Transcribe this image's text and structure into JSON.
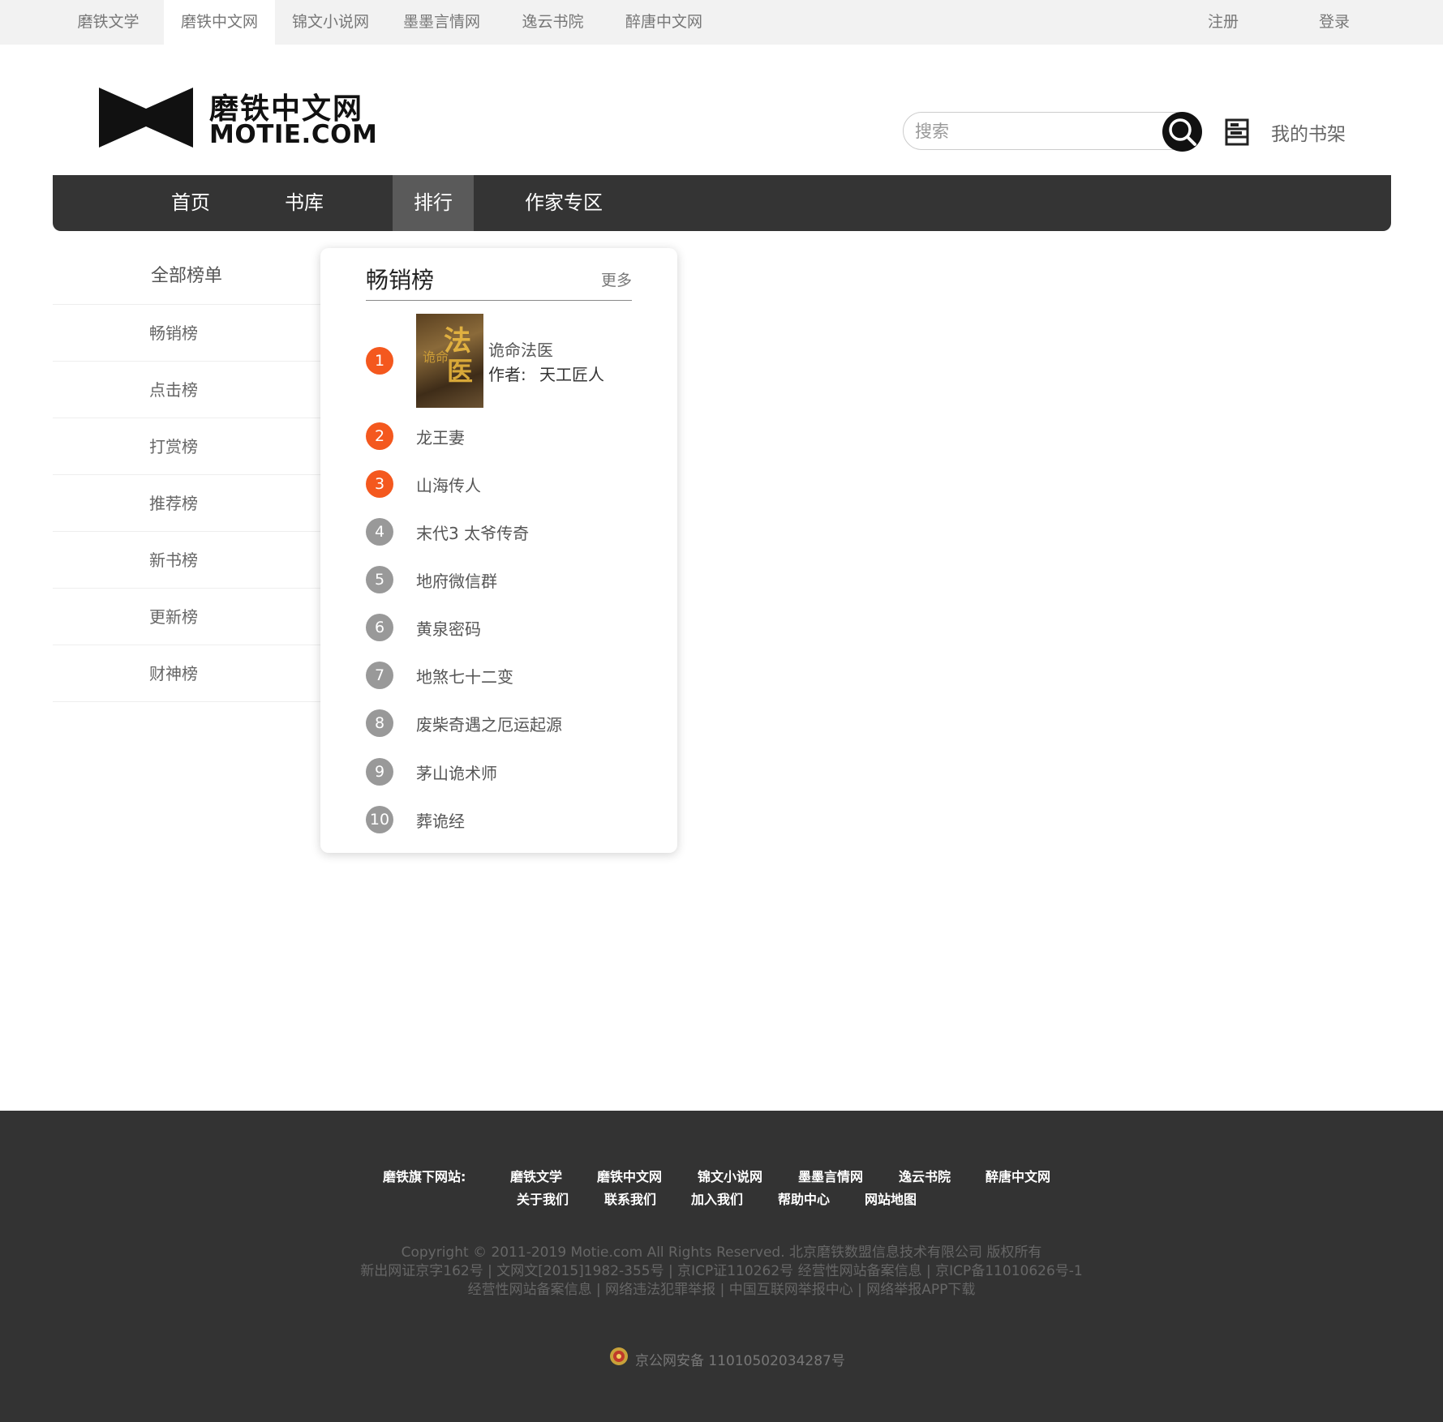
{
  "topbar": {
    "sites": [
      "磨铁文学",
      "磨铁中文网",
      "锦文小说网",
      "墨墨言情网",
      "逸云书院",
      "醉唐中文网"
    ],
    "register": "注册",
    "login": "登录"
  },
  "header": {
    "logo_cn": "磨铁中文网",
    "logo_en": "MOTIE.COM",
    "search_placeholder": "搜索",
    "shelf_label": "我的书架"
  },
  "nav": {
    "items": [
      "首页",
      "书库",
      "排行",
      "作家专区"
    ],
    "active": "排行"
  },
  "sidebar": {
    "head": "全部榜单",
    "items": [
      "畅销榜",
      "点击榜",
      "打赏榜",
      "推荐榜",
      "新书榜",
      "更新榜",
      "财神榜"
    ]
  },
  "ranking": {
    "title": "畅销榜",
    "more": "更多",
    "top": {
      "rank": "1",
      "name": "诡命法医",
      "author_label": "作者:",
      "author": "天工匠人",
      "cover_text": [
        "法",
        "医",
        "诡命"
      ]
    },
    "list": [
      {
        "rank": "2",
        "name": "龙王妻"
      },
      {
        "rank": "3",
        "name": "山海传人"
      },
      {
        "rank": "4",
        "name": "末代3 太爷传奇"
      },
      {
        "rank": "5",
        "name": "地府微信群"
      },
      {
        "rank": "6",
        "name": "黄泉密码"
      },
      {
        "rank": "7",
        "name": "地煞七十二变"
      },
      {
        "rank": "8",
        "name": "废柴奇遇之厄运起源"
      },
      {
        "rank": "9",
        "name": "茅山诡术师"
      },
      {
        "rank": "10",
        "name": "葬诡经"
      }
    ]
  },
  "footer": {
    "sites_label": "磨铁旗下网站:",
    "sites": [
      "磨铁文学",
      "磨铁中文网",
      "锦文小说网",
      "墨墨言情网",
      "逸云书院",
      "醉唐中文网"
    ],
    "links": [
      "关于我们",
      "联系我们",
      "加入我们",
      "帮助中心",
      "网站地图"
    ],
    "copyright": "Copyright © 2011-2019 Motie.com All Rights Reserved. 北京磨铁数盟信息技术有限公司 版权所有",
    "licenses": "新出网证京字162号 | 文网文[2015]1982-355号 | 京ICP证110262号 经营性网站备案信息 | 京ICP备11010626号-1",
    "reports": "经营性网站备案信息 | 网络违法犯罪举报 | 中国互联网举报中心 | 网络举报APP下载",
    "police": "京公网安备 11010502034287号"
  },
  "colors": {
    "accent_hot": "#f4581e",
    "rank_normal": "#999999",
    "nav_bg": "#343434",
    "footer_bg": "#333333"
  }
}
